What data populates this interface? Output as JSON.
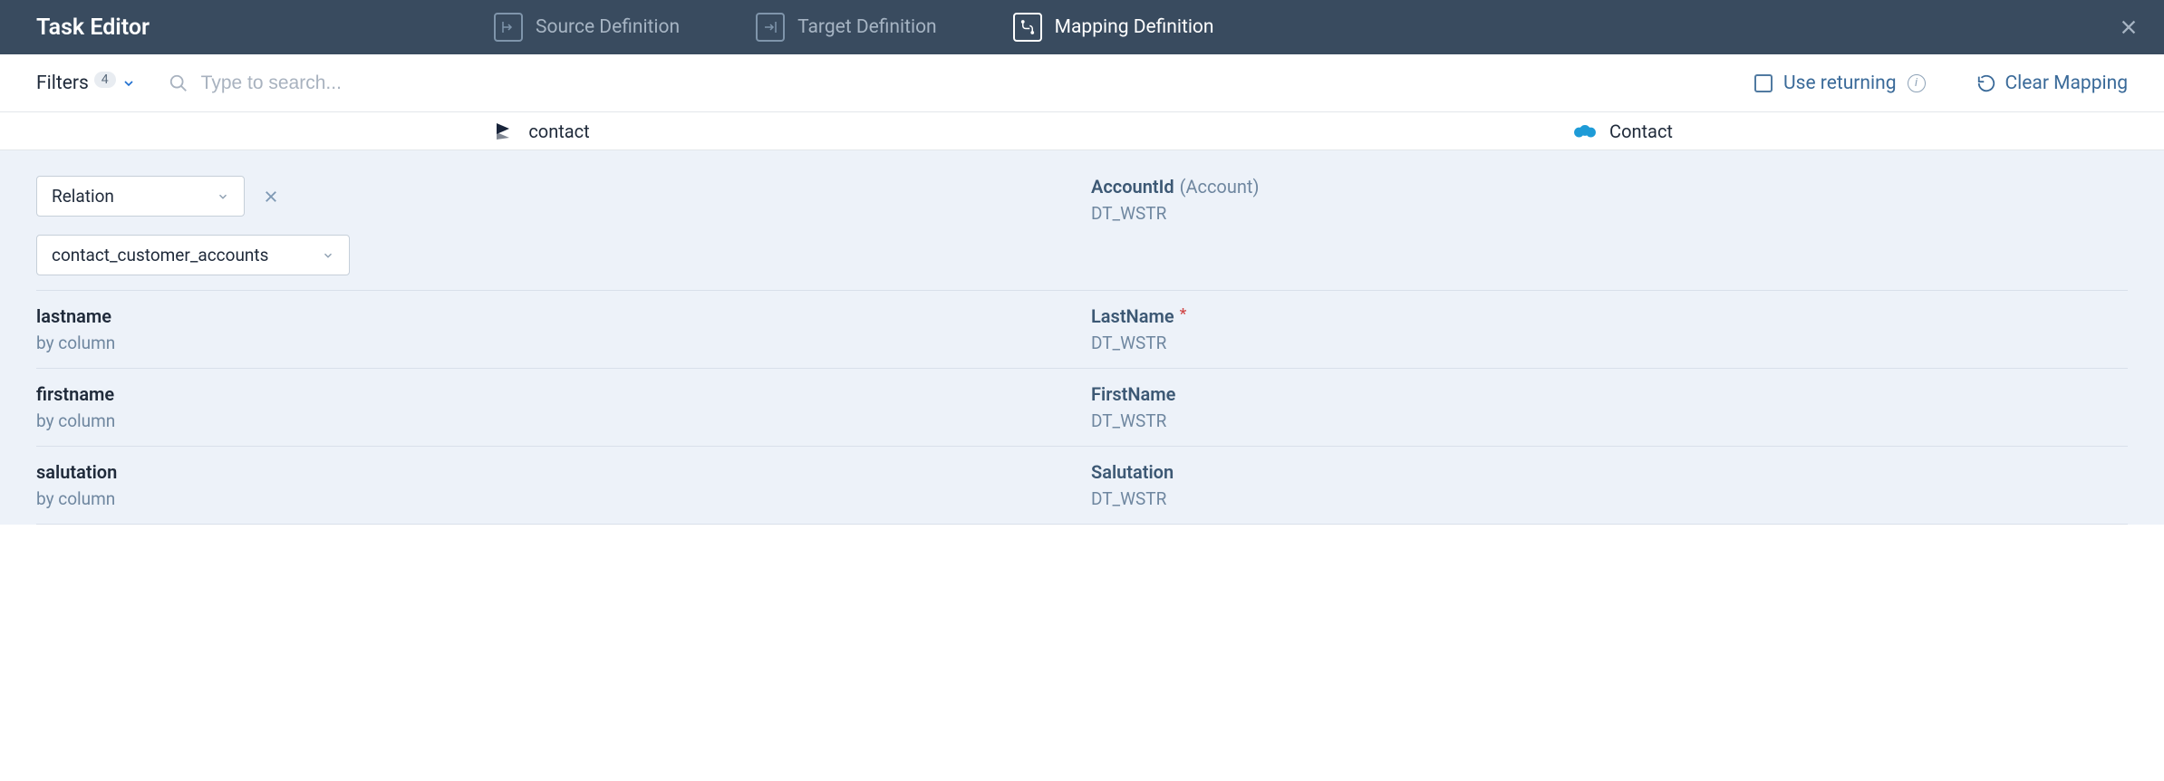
{
  "header": {
    "title": "Task Editor",
    "tabs": [
      {
        "label": "Source Definition",
        "active": false
      },
      {
        "label": "Target Definition",
        "active": false
      },
      {
        "label": "Mapping Definition",
        "active": true
      }
    ]
  },
  "toolbar": {
    "filters_label": "Filters",
    "filters_count": "4",
    "search_placeholder": "Type to search...",
    "use_returning_label": "Use returning",
    "clear_mapping_label": "Clear Mapping"
  },
  "entities": {
    "source_label": "contact",
    "target_label": "Contact"
  },
  "rows": {
    "relation": {
      "type_select": "Relation",
      "value_select": "contact_customer_accounts",
      "target_field": "AccountId",
      "target_note": "(Account)",
      "target_type": "DT_WSTR"
    },
    "items": [
      {
        "source": "lastname",
        "source_sub": "by column",
        "target": "LastName",
        "required": true,
        "type": "DT_WSTR"
      },
      {
        "source": "firstname",
        "source_sub": "by column",
        "target": "FirstName",
        "required": false,
        "type": "DT_WSTR"
      },
      {
        "source": "salutation",
        "source_sub": "by column",
        "target": "Salutation",
        "required": false,
        "type": "DT_WSTR"
      }
    ]
  }
}
